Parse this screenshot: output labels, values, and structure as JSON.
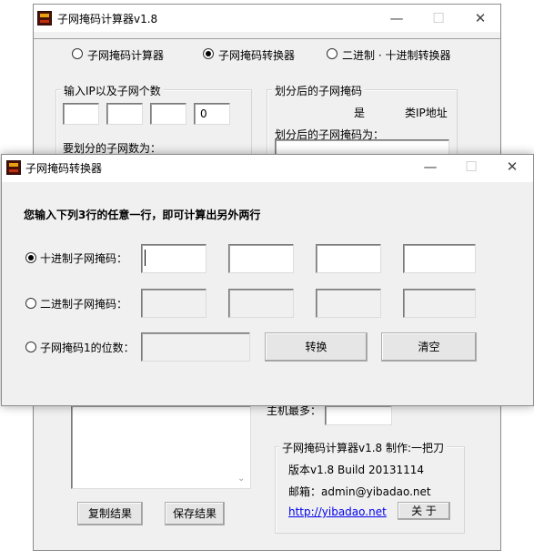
{
  "main_window": {
    "title": "子网掩码计算器v1.8",
    "mode_options": [
      {
        "label": "子网掩码计算器",
        "selected": false
      },
      {
        "label": "子网掩码转换器",
        "selected": true
      },
      {
        "label": "二进制 · 十进制转换器",
        "selected": false
      }
    ],
    "ip_group": {
      "title": "输入IP以及子网个数",
      "octets": [
        "",
        "",
        "",
        "0"
      ],
      "subnet_count_label": "要划分的子网数为："
    },
    "result_group": {
      "title": "划分后的子网掩码",
      "is_label": "是",
      "class_label": "类IP地址",
      "mask_label": "划分后的子网掩码为：",
      "mask_value": ""
    },
    "host_max_label": "主机最多：",
    "host_max_value": "",
    "result_list_text": "",
    "copy_button": "复制结果",
    "save_button": "保存结果",
    "about_group": {
      "title": "子网掩码计算器v1.8 制作:一把刀",
      "version": "版本v1.8  Build 20131114",
      "email": "邮箱：admin@yibadao.net",
      "link": "http://yibadao.net",
      "about_button": "关  于"
    }
  },
  "dialog": {
    "title": "子网掩码转换器",
    "instruction": "您输入下列3行的任意一行，即可计算出另外两行",
    "rows": [
      {
        "label": "十进制子网掩码：",
        "selected": true,
        "values": [
          "",
          "",
          "",
          ""
        ]
      },
      {
        "label": "二进制子网掩码：",
        "selected": false,
        "values": [
          "",
          "",
          "",
          ""
        ]
      },
      {
        "label": "子网掩码1的位数：",
        "selected": false,
        "values": [
          ""
        ]
      }
    ],
    "convert_button": "转换",
    "clear_button": "清空"
  }
}
